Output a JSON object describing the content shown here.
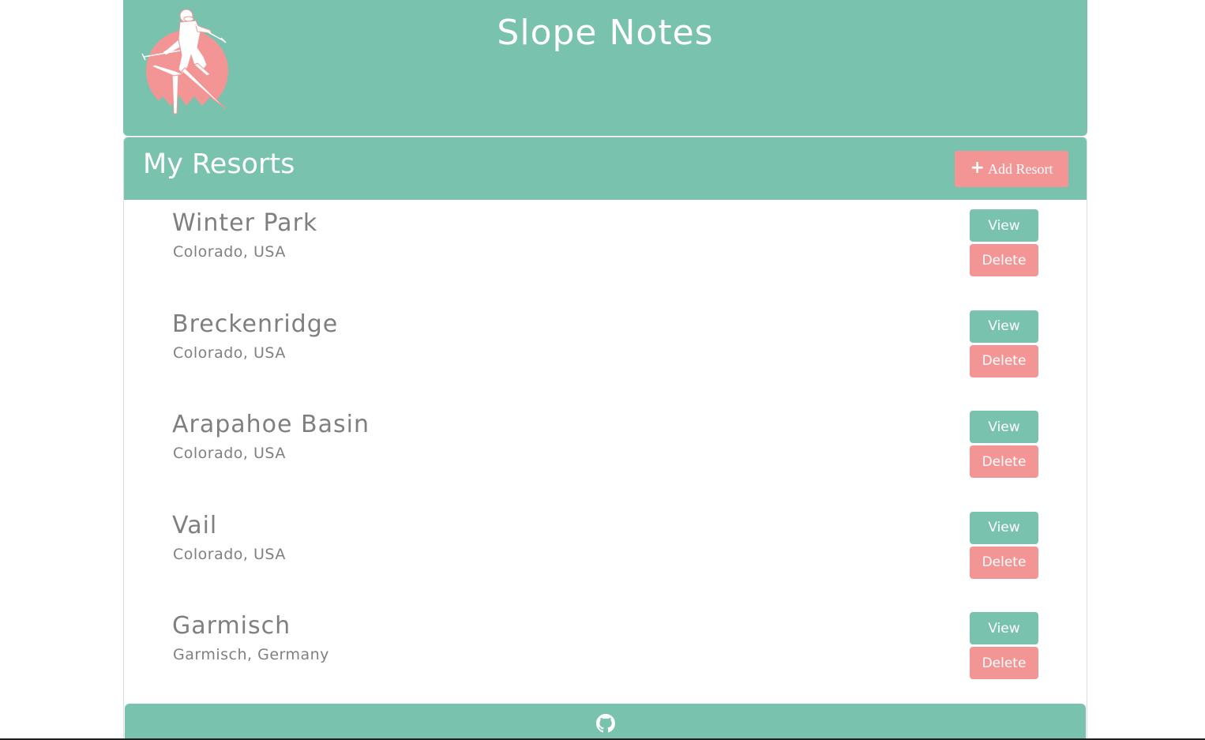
{
  "header": {
    "title": "Slope Notes",
    "logo_icon": "skier-logo-icon"
  },
  "resorts_section": {
    "title": "My Resorts",
    "add_button_label": "Add Resort",
    "add_icon": "plus-icon"
  },
  "resorts": [
    {
      "name": "Winter Park",
      "location": "Colorado, USA",
      "view_label": "View",
      "delete_label": "Delete"
    },
    {
      "name": "Breckenridge",
      "location": "Colorado, USA",
      "view_label": "View",
      "delete_label": "Delete"
    },
    {
      "name": "Arapahoe Basin",
      "location": "Colorado, USA",
      "view_label": "View",
      "delete_label": "Delete"
    },
    {
      "name": "Vail",
      "location": "Colorado, USA",
      "view_label": "View",
      "delete_label": "Delete"
    },
    {
      "name": "Garmisch",
      "location": "Garmisch, Germany",
      "view_label": "View",
      "delete_label": "Delete"
    }
  ],
  "footer": {
    "icon": "github-icon"
  },
  "colors": {
    "primary": "#79c2ad",
    "accent": "#f39595",
    "text_muted": "#7f7f7f",
    "white": "#ffffff"
  }
}
